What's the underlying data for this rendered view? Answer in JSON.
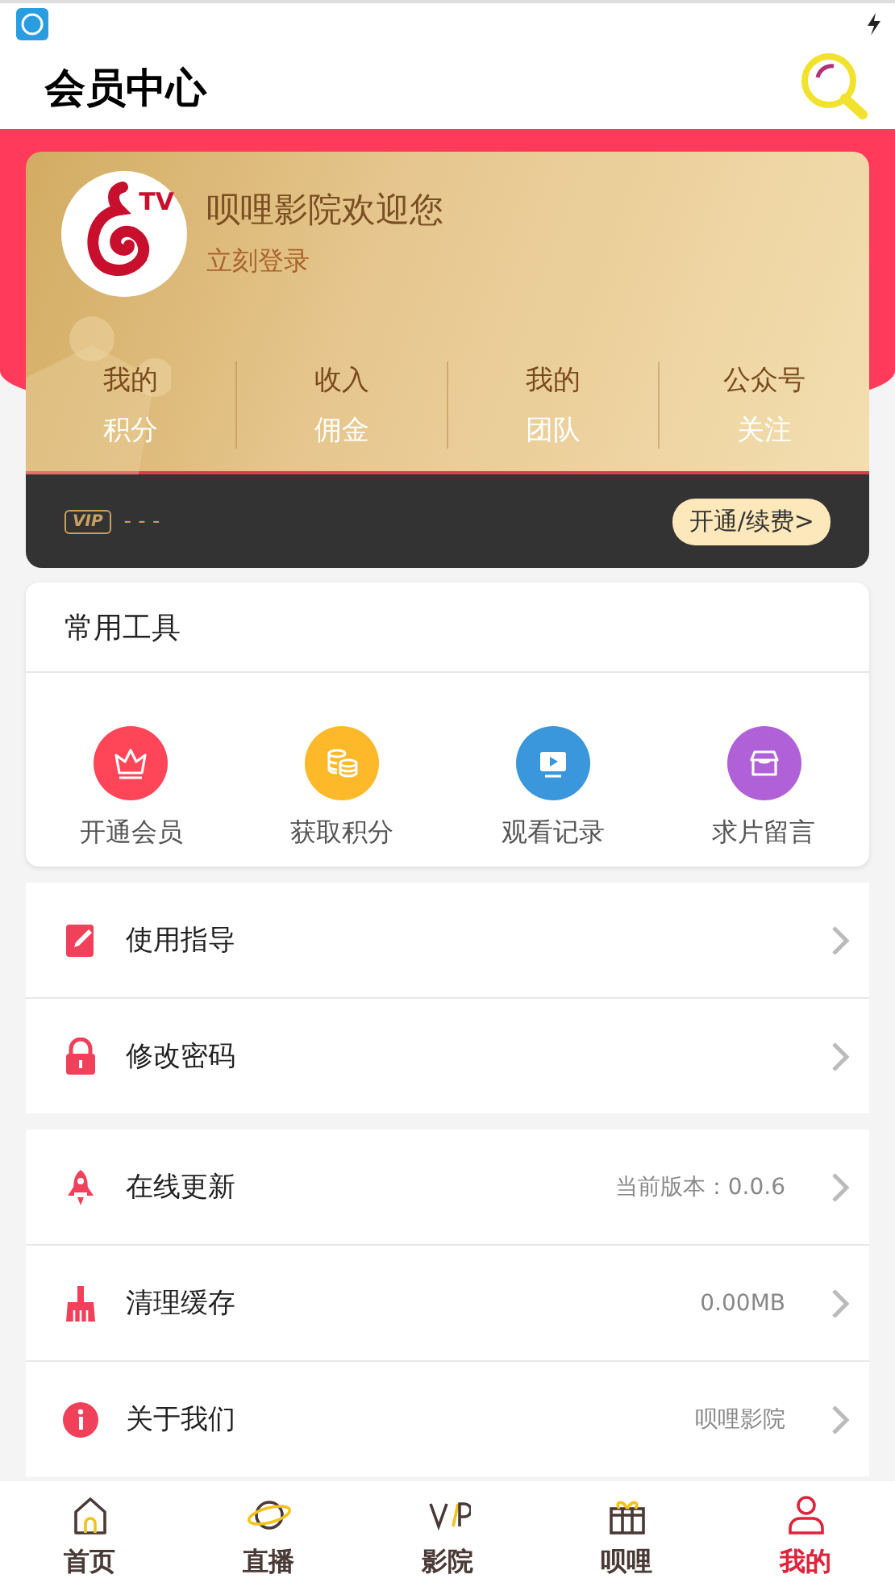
{
  "header": {
    "title": "会员中心"
  },
  "profile": {
    "logo_text": "TV",
    "welcome": "呗哩影院欢迎您",
    "login_link": "立刻登录"
  },
  "stats": [
    {
      "top": "我的",
      "bottom": "积分"
    },
    {
      "top": "收入",
      "bottom": "佣金"
    },
    {
      "top": "我的",
      "bottom": "团队"
    },
    {
      "top": "公众号",
      "bottom": "关注"
    }
  ],
  "vip_bar": {
    "badge": "VIP",
    "status": "- - -",
    "button": "开通/续费>"
  },
  "tools": {
    "title": "常用工具",
    "items": [
      {
        "kind": "crown",
        "label": "开通会员",
        "color": "#ff4558"
      },
      {
        "kind": "coins",
        "label": "获取积分",
        "color": "#fdb92a"
      },
      {
        "kind": "tv",
        "label": "观看记录",
        "color": "#3a97dc"
      },
      {
        "kind": "shop",
        "label": "求片留言",
        "color": "#b061d8"
      }
    ]
  },
  "menu_groups": [
    [
      {
        "kind": "guide",
        "label": "使用指导"
      },
      {
        "kind": "lock",
        "label": "修改密码"
      }
    ],
    [
      {
        "kind": "rocket",
        "label": "在线更新",
        "value": "当前版本：0.0.6"
      },
      {
        "kind": "broom",
        "label": "清理缓存",
        "value": "0.00MB"
      },
      {
        "kind": "info",
        "label": "关于我们",
        "value": "呗哩影院"
      }
    ]
  ],
  "tab_bar": [
    {
      "kind": "home",
      "label": "首页",
      "selected": false
    },
    {
      "kind": "planet",
      "label": "直播",
      "selected": false
    },
    {
      "kind": "vip",
      "label": "影院",
      "selected": false
    },
    {
      "kind": "gift",
      "label": "呗哩",
      "selected": false
    },
    {
      "kind": "user",
      "label": "我的",
      "selected": true
    }
  ]
}
